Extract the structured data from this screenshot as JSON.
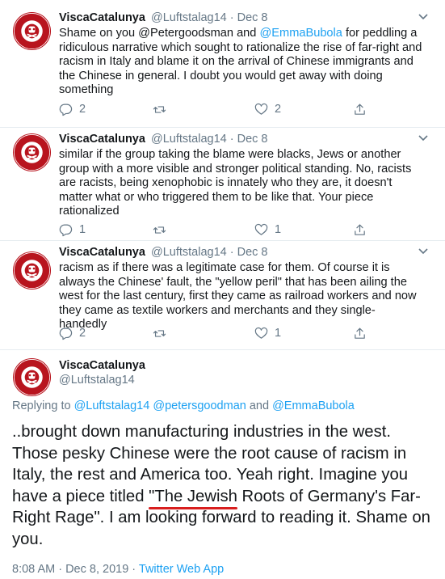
{
  "tweets": [
    {
      "name": "ViscaCatalunya",
      "handle": "@Luftstalag14",
      "dot": "·",
      "date": "Dec 8",
      "text_1": "Shame on you @Petergoodsman and ",
      "text_link": "@EmmaBubola",
      "text_2": " for peddling a ridiculous narrative which sought to rationalize the rise of far-right and racism in Italy and blame it on the arrival of Chinese immigrants and the Chinese in general. I doubt you would get away with doing something",
      "replies": "2",
      "retweets": "",
      "likes": "2"
    },
    {
      "name": "ViscaCatalunya",
      "handle": "@Luftstalag14",
      "dot": "·",
      "date": "Dec 8",
      "text": "similar if the group taking the blame were blacks, Jews or another group with a more visible and stronger political standing. No, racists are racists, being xenophobic is innately who they are, it doesn't matter what or who triggered them to be like that. Your piece rationalized",
      "replies": "1",
      "retweets": "",
      "likes": "1"
    },
    {
      "name": "ViscaCatalunya",
      "handle": "@Luftstalag14",
      "dot": "·",
      "date": "Dec 8",
      "text": "racism as if there was a legitimate case for them. Of course it is always the Chinese' fault, the \"yellow peril\" that has been ailing the west for the last century, first they came as railroad workers and now they came as textile workers and merchants and they single-handedly",
      "replies": "2",
      "retweets": "",
      "likes": "1"
    }
  ],
  "main": {
    "name": "ViscaCatalunya",
    "handle": "@Luftstalag14",
    "replying_prefix": "Replying to ",
    "replying_1": "@Luftstalag14",
    "replying_2": "@petersgoodman",
    "replying_and": " and ",
    "replying_3": "@EmmaBubola",
    "text_1": "..brought down manufacturing industries in the west. Those pesky Chinese were the root cause of racism in Italy, the rest and America too. Yeah right. Imagine you have a piece titled ",
    "text_underlined_1": "\"The Jewish",
    "text_underlined_2": "Roots of Germany's Far-Right Rage\".",
    "text_2": " I am looking forward to reading it. Shame on you.",
    "time": "8:08 AM · Dec 8, 2019 · ",
    "client": "Twitter Web App"
  },
  "avatar_text_top": "FC ST. PAULI",
  "avatar_text_bottom": "1910",
  "colors": {
    "accent": "#1da1f2",
    "muted": "#657786",
    "avatar_red": "#b8141e",
    "underline": "#d81e1e"
  },
  "icons": [
    "reply-icon",
    "retweet-icon",
    "like-icon",
    "share-icon",
    "chevron-down-icon"
  ]
}
